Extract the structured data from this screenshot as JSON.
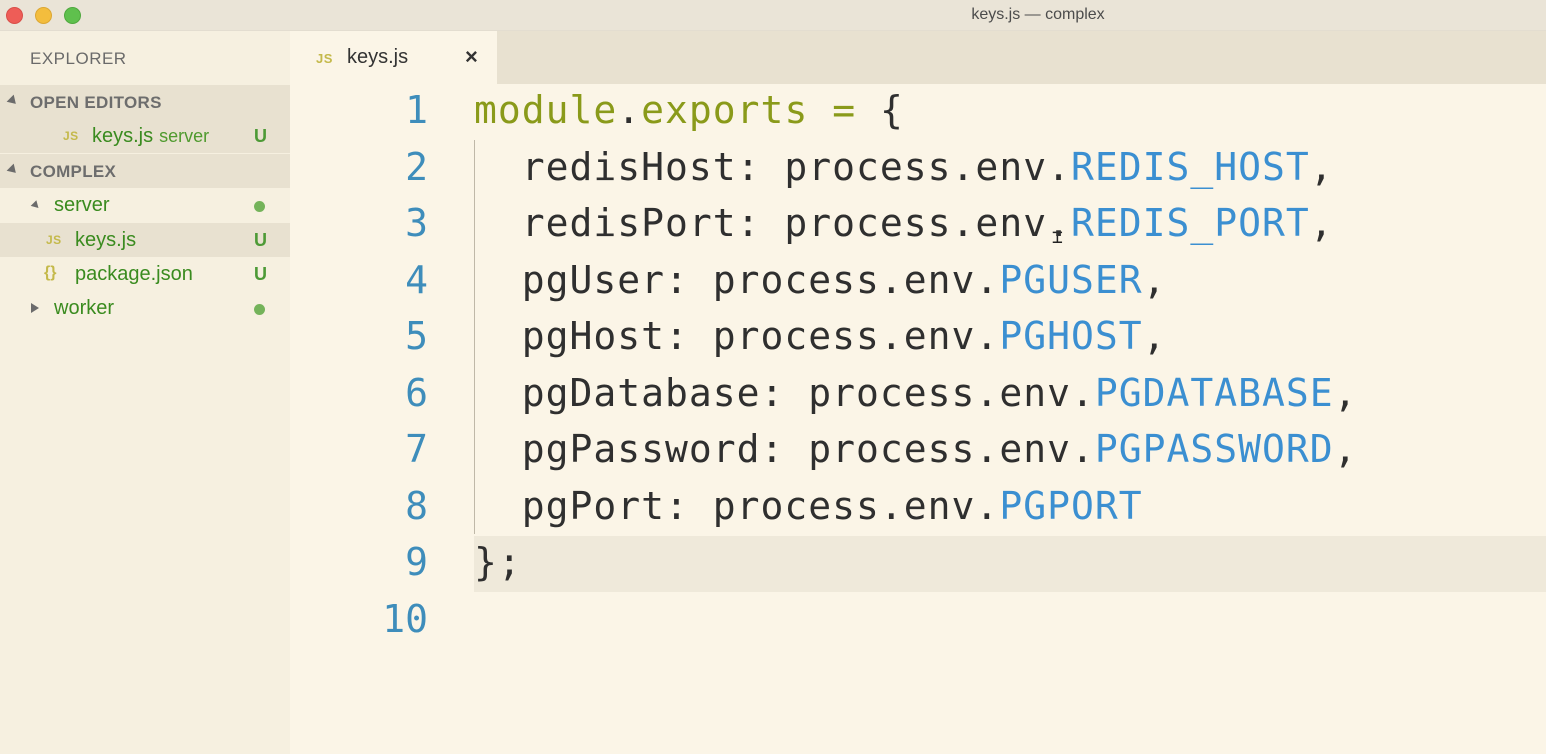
{
  "window": {
    "title": "keys.js — complex"
  },
  "sidebar": {
    "title": "EXPLORER",
    "open_editors": {
      "header": "OPEN EDITORS",
      "items": [
        {
          "icon": "JS",
          "name": "keys.js",
          "desc": "server",
          "status": "U"
        }
      ]
    },
    "project": {
      "header": "COMPLEX",
      "folders": [
        {
          "name": "server",
          "expanded": true,
          "status_color": "#74b35a",
          "children": [
            {
              "icon": "JS",
              "name": "keys.js",
              "status": "U"
            },
            {
              "icon": "{}",
              "name": "package.json",
              "status": "U"
            }
          ]
        },
        {
          "name": "worker",
          "expanded": false,
          "status_color": "#74b35a"
        }
      ]
    }
  },
  "tabs": [
    {
      "icon": "JS",
      "label": "keys.js",
      "close": "×"
    }
  ],
  "editor": {
    "lines": [
      {
        "n": "1",
        "tokens": [
          {
            "t": "module",
            "c": "kw"
          },
          {
            "t": ".",
            "c": ""
          },
          {
            "t": "exports",
            "c": "kw"
          },
          {
            "t": " = ",
            "c": "op"
          },
          {
            "t": "{",
            "c": ""
          }
        ]
      },
      {
        "n": "2",
        "tokens": [
          {
            "t": "  redisHost: process.env.",
            "c": ""
          },
          {
            "t": "REDIS_HOST",
            "c": "const"
          },
          {
            "t": ",",
            "c": ""
          }
        ]
      },
      {
        "n": "3",
        "tokens": [
          {
            "t": "  redisPort: process.env.",
            "c": ""
          },
          {
            "t": "REDIS_PORT",
            "c": "const"
          },
          {
            "t": ",",
            "c": ""
          }
        ]
      },
      {
        "n": "4",
        "tokens": [
          {
            "t": "  pgUser: process.env.",
            "c": ""
          },
          {
            "t": "PGUSER",
            "c": "const"
          },
          {
            "t": ",",
            "c": ""
          }
        ]
      },
      {
        "n": "5",
        "tokens": [
          {
            "t": "  pgHost: process.env.",
            "c": ""
          },
          {
            "t": "PGHOST",
            "c": "const"
          },
          {
            "t": ",",
            "c": ""
          }
        ]
      },
      {
        "n": "6",
        "tokens": [
          {
            "t": "  pgDatabase: process.env.",
            "c": ""
          },
          {
            "t": "PGDATABASE",
            "c": "const"
          },
          {
            "t": ",",
            "c": ""
          }
        ]
      },
      {
        "n": "7",
        "tokens": [
          {
            "t": "  pgPassword: process.env.",
            "c": ""
          },
          {
            "t": "PGPASSWORD",
            "c": "const"
          },
          {
            "t": ",",
            "c": ""
          }
        ]
      },
      {
        "n": "8",
        "tokens": [
          {
            "t": "  pgPort: process.env.",
            "c": ""
          },
          {
            "t": "PGPORT",
            "c": "const"
          }
        ]
      },
      {
        "n": "9",
        "tokens": [
          {
            "t": "};",
            "c": ""
          }
        ],
        "current": true
      },
      {
        "n": "10",
        "tokens": []
      }
    ]
  },
  "colors": {
    "keyword": "#8a9a1a",
    "constant": "#3b8fd1",
    "line_number": "#3e8dbb",
    "git_untracked": "#4d9a36"
  }
}
